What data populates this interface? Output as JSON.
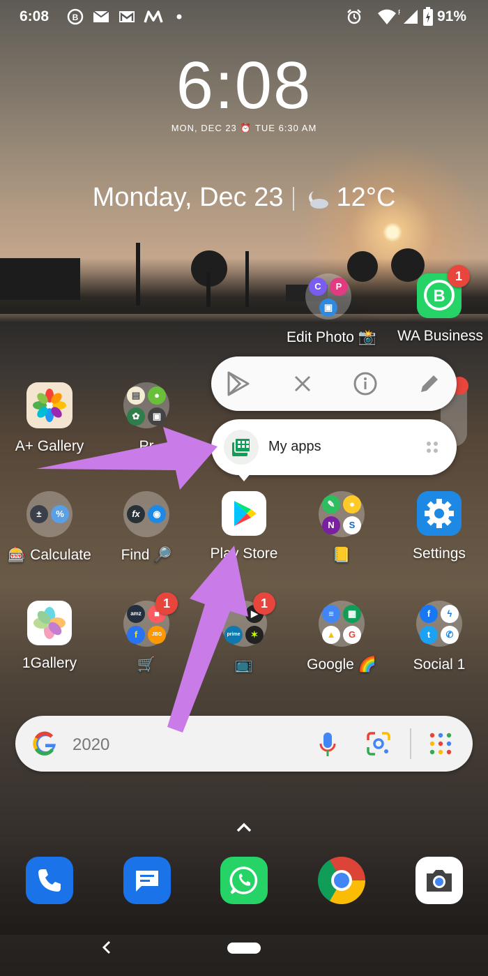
{
  "status_bar": {
    "time": "6:08",
    "battery": "91%"
  },
  "clock": {
    "time": "6:08",
    "date_alarm": "MON, DEC 23  ⏰ TUE 6:30 AM"
  },
  "at_a_glance": {
    "date": "Monday, Dec 23",
    "temperature": "12°C"
  },
  "home_row1": [
    {
      "label": "Edit Photo 📸"
    },
    {
      "label": "WA Business",
      "badge": "1"
    }
  ],
  "home_row2": [
    {
      "label": "A+ Gallery"
    },
    {
      "label": "Pr"
    }
  ],
  "popup": {
    "actions": [
      "play-store-icon",
      "close-icon",
      "info-icon",
      "edit-icon"
    ],
    "shortcut_label": "My apps"
  },
  "home_row3": [
    {
      "label": "🎰 Calculate"
    },
    {
      "label": "Find 🔎"
    },
    {
      "label": "Play Store"
    },
    {
      "label": "📒"
    },
    {
      "label": "Settings"
    }
  ],
  "home_row4": [
    {
      "label": "1Gallery"
    },
    {
      "label": "🛒",
      "badge": "1"
    },
    {
      "label": "📺",
      "badge": "1"
    },
    {
      "label": "Google 🌈"
    },
    {
      "label": "Social 1"
    }
  ],
  "search": {
    "query": "2020"
  },
  "dock": [
    "phone-icon",
    "messages-icon",
    "whatsapp-icon",
    "chrome-icon",
    "camera-icon"
  ],
  "annotation_color": "#c97ce8"
}
